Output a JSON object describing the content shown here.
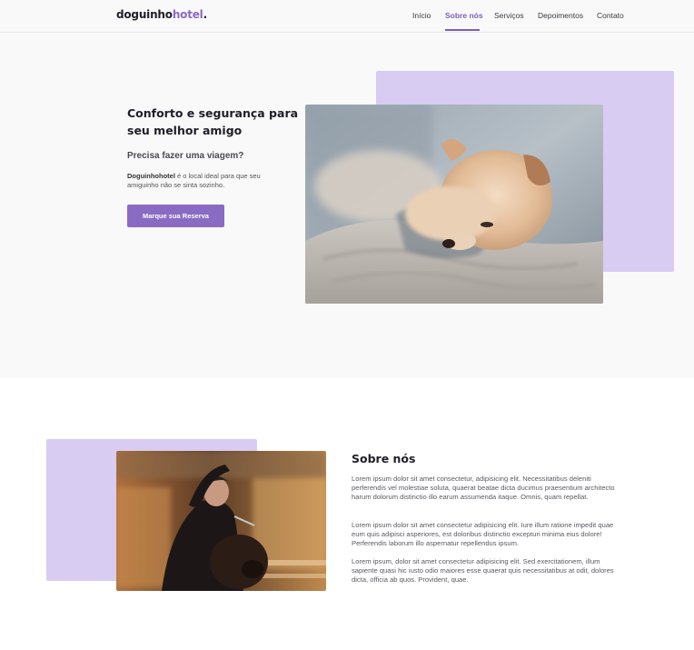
{
  "nav": {
    "logo_main": "doguinho",
    "logo_accent": "hotel",
    "logo_dot": ".",
    "links": [
      "Início",
      "Sobre nós",
      "Serviços",
      "Depoimentos",
      "Contato"
    ],
    "active_index": 1
  },
  "hero": {
    "title": "Conforto e segurança para seu melhor amigo",
    "subtitle": "Precisa fazer uma viagem?",
    "desc_bold": "Doguinhohotel",
    "desc_rest": " é o local ideal para que seu amiguinho não se sinta sozinho.",
    "cta_label": "Marque sua Reserva"
  },
  "about": {
    "title": "Sobre nós",
    "paragraphs": [
      "Lorem ipsum dolor sit amet consectetur, adipisicing elit. Necessitatibus deleniti perferendis vel molestiae soluta, quaerat beatae dicta ducimus praesentium architecto harum dolorum distinctio illo earum assumenda itaque. Omnis, quam repellat.",
      "Lorem ipsum dolor sit amet consectetur adipisicing elit. Iure illum ratione impedit quae eum quis adipisci asperiores, est doloribus distinctio excepturi minima eius dolore! Perferendis laborum illo aspernatur repellendus ipsum.",
      "Lorem ipsum, dolor sit amet consectetur adipisicing elit. Sed exercitationem, illum sapiente quasi hic iusto odio maiores esse quaerat quis necessitatibus at odit, dolores dicta, officia ab quos. Provident, quae."
    ]
  },
  "colors": {
    "accent": "#8a6bc4",
    "lavender": "#d8ccf2",
    "hero_bg": "#f9f9f9"
  }
}
